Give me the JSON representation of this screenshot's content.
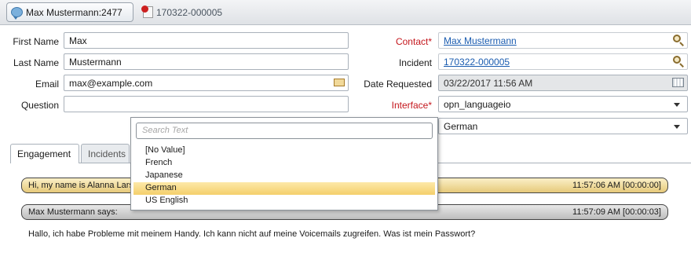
{
  "tabs": {
    "chat": "Max Mustermann:2477",
    "incident": "170322-000005"
  },
  "form": {
    "first_name_label": "First Name",
    "first_name_value": "Max",
    "last_name_label": "Last Name",
    "last_name_value": "Mustermann",
    "email_label": "Email",
    "email_value": "max@example.com",
    "question_label": "Question",
    "question_value": "",
    "contact_label": "Contact",
    "contact_value": "Max Mustermann",
    "incident_label": "Incident",
    "incident_value": "170322-000005",
    "date_requested_label": "Date Requested",
    "date_requested_value": "03/22/2017 11:56 AM",
    "interface_label": "Interface",
    "interface_value": "opn_languageio",
    "language_value": "German",
    "required_marker": "*"
  },
  "content_tabs": {
    "engagement": "Engagement",
    "incidents": "Incidents"
  },
  "transcript": {
    "agent_text": "Hi, my name is Alanna Lars",
    "agent_time": "11:57:06 AM [00:00:00]",
    "customer_text": "Max Mustermann says:",
    "customer_time": "11:57:09 AM [00:00:03]",
    "message": "Hallo, ich habe Probleme mit meinem Handy. Ich kann nicht auf meine Voicemails zugreifen. Was ist mein Passwort?"
  },
  "dropdown": {
    "placeholder": "Search Text",
    "options": [
      "[No Value]",
      "French",
      "Japanese",
      "German",
      "US English"
    ],
    "selected": "German"
  },
  "colors": {
    "required": "#c4161c",
    "link": "#1a5cb0",
    "selection": "#f4cf6b"
  },
  "icons": {
    "chat_tab": "chat-bubble-icon",
    "incident_tab": "incident-icon",
    "lookup": "magnifier-icon",
    "email": "envelope-icon",
    "date": "calendar-icon"
  }
}
